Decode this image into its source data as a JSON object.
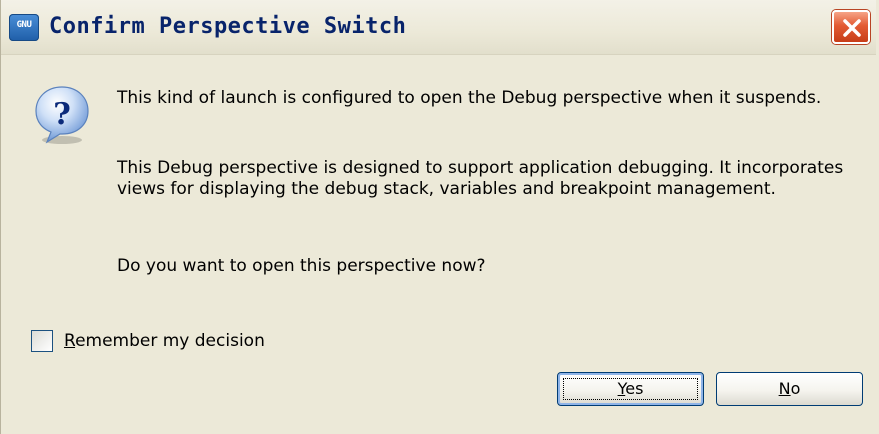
{
  "window": {
    "title": "Confirm Perspective Switch",
    "app_icon_text": "GNU",
    "colors": {
      "dialog_background": "#ece9d8",
      "title_text": "#08246b",
      "close_button": "#e35b34",
      "button_border": "#003c74"
    }
  },
  "icons": {
    "app": "gnu-app-icon",
    "close": "close-icon",
    "message": "question-icon"
  },
  "message": {
    "paragraph1": "This kind of launch is configured to open the Debug perspective when it suspends.",
    "paragraph2": "This Debug perspective is designed to support application debugging. It incorporates views for displaying the debug stack, variables and breakpoint management.",
    "paragraph3": "Do you want to open this perspective now?"
  },
  "remember": {
    "mnemonic": "R",
    "label_rest": "emember my decision",
    "checked": false
  },
  "buttons": {
    "yes": {
      "mnemonic": "Y",
      "label_rest": "es",
      "focused": true
    },
    "no": {
      "mnemonic": "N",
      "label_rest": "o",
      "focused": false
    }
  }
}
